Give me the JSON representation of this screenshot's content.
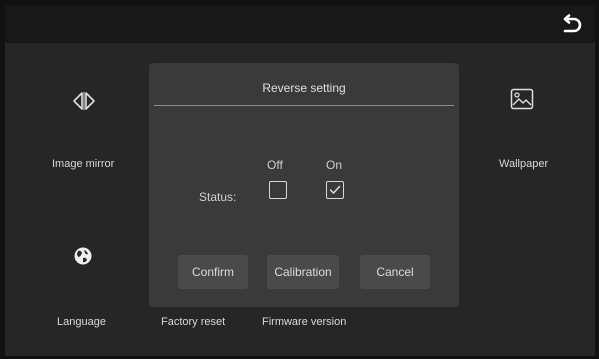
{
  "header": {
    "back_icon": "return-arrow-icon"
  },
  "tiles": {
    "image_mirror": {
      "label": "Image mirror",
      "icon": "mirror-flip-icon"
    },
    "wallpaper": {
      "label": "Wallpaper",
      "icon": "image-icon"
    },
    "language": {
      "label": "Language",
      "icon": "globe-icon"
    },
    "factory_reset": {
      "label": "Factory reset"
    },
    "firmware_version": {
      "label": "Firmware version"
    }
  },
  "dialog": {
    "title": "Reverse setting",
    "status_label": "Status:",
    "options": [
      {
        "label": "Off",
        "checked": false
      },
      {
        "label": "On",
        "checked": true
      }
    ],
    "buttons": {
      "confirm": "Confirm",
      "calibration": "Calibration",
      "cancel": "Cancel"
    }
  }
}
